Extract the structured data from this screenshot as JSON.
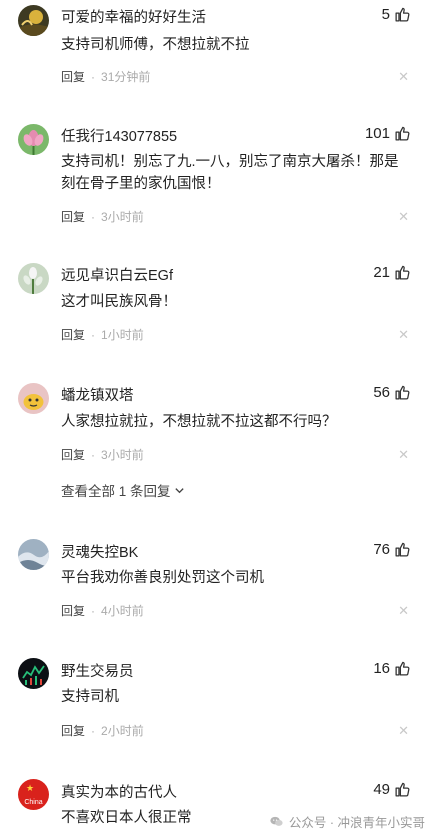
{
  "comments": [
    {
      "name": "可爱的幸福的好好生活",
      "likes": "5",
      "text": "支持司机师傅，不想拉就不拉",
      "reply": "回复",
      "sep": "·",
      "time": "31分钟前",
      "avatar": "landscape-avatar"
    },
    {
      "name": "任我行143077855",
      "likes": "101",
      "text": "支持司机！别忘了九.一八，别忘了南京大屠杀！那是刻在骨子里的家仇国恨！",
      "reply": "回复",
      "sep": "·",
      "time": "3小时前",
      "avatar": "lotus-avatar"
    },
    {
      "name": "远见卓识白云EGf",
      "likes": "21",
      "text": "这才叫民族风骨！",
      "reply": "回复",
      "sep": "·",
      "time": "1小时前",
      "avatar": "flower-avatar"
    },
    {
      "name": "蟠龙镇双塔",
      "likes": "56",
      "text": "人家想拉就拉，不想拉就不拉这都不行吗？",
      "reply": "回复",
      "sep": "·",
      "time": "3小时前",
      "avatar": "cartoon-avatar",
      "view_replies": "查看全部 1 条回复"
    },
    {
      "name": "灵魂失控BK",
      "likes": "76",
      "text": "平台我劝你善良别处罚这个司机",
      "reply": "回复",
      "sep": "·",
      "time": "4小时前",
      "avatar": "sky-avatar"
    },
    {
      "name": "野生交易员",
      "likes": "16",
      "text": "支持司机",
      "reply": "回复",
      "sep": "·",
      "time": "2小时前",
      "avatar": "chart-avatar"
    },
    {
      "name": "真实为本的古代人",
      "likes": "49",
      "text": "不喜欢日本人很正常",
      "avatar": "china-avatar",
      "avatar_text": "China"
    }
  ],
  "watermark": {
    "text": "公众号 · 冲浪青年小实哥"
  },
  "icons": {
    "like": "thumbs-up-icon",
    "close": "close-icon",
    "expand": "chevron-down-icon",
    "wechat": "wechat-icon"
  },
  "close_glyph": "✕"
}
